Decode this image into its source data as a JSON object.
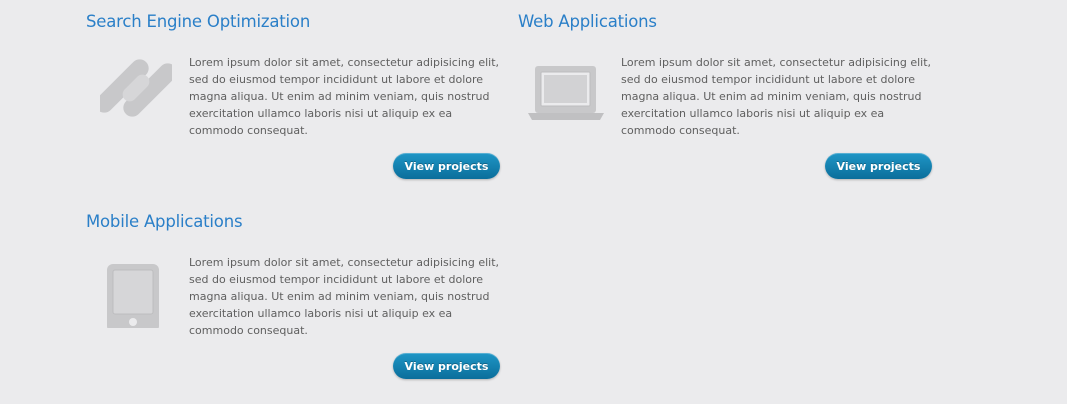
{
  "services": [
    {
      "title": "Search Engine Optimization",
      "icon": "link-chain-icon",
      "description": "Lorem ipsum dolor sit amet, consectetur adipisicing elit, sed do eiusmod tempor incididunt ut labore et dolore magna aliqua. Ut enim ad minim veniam, quis nostrud exercitation ullamco laboris nisi ut aliquip ex ea commodo consequat.",
      "button_label": "View projects"
    },
    {
      "title": "Web Applications",
      "icon": "laptop-icon",
      "description": "Lorem ipsum dolor sit amet, consectetur adipisicing elit, sed do eiusmod tempor incididunt ut labore et dolore magna aliqua. Ut enim ad minim veniam, quis nostrud exercitation ullamco laboris nisi ut aliquip ex ea commodo consequat.",
      "button_label": "View projects"
    },
    {
      "title": "Mobile Applications",
      "icon": "tablet-icon",
      "description": "Lorem ipsum dolor sit amet, consectetur adipisicing elit, sed do eiusmod tempor incididunt ut labore et dolore magna aliqua. Ut enim ad minim veniam, quis nostrud exercitation ullamco laboris nisi ut aliquip ex ea commodo consequat.",
      "button_label": "View projects"
    }
  ],
  "colors": {
    "background": "#ebebed",
    "title": "#2a7fc8",
    "body_text": "#5f5f5f",
    "icon": "#c8c8ca",
    "button": "#1583b3"
  }
}
